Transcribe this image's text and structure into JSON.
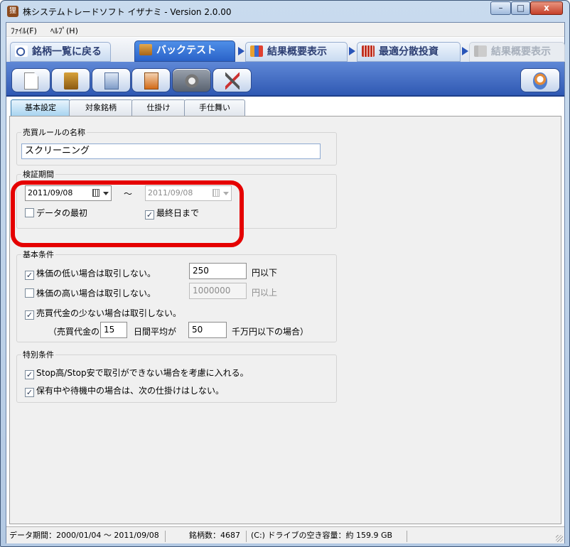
{
  "window": {
    "title": "株システムトレードソフト イザナミ - Version 2.0.00",
    "app_icon": "tanuki-app-icon",
    "controls": {
      "minimize": "–",
      "maximize": "□",
      "close": "x"
    }
  },
  "menu": {
    "file": "ﾌｧｲﾙ(F)",
    "help": "ﾍﾙﾌﾟ(H)"
  },
  "nav": {
    "back": "銘柄一覧に戻る",
    "backtest": "バックテスト",
    "summary": "結果概要表示",
    "optimize": "最適分散投資",
    "summary2": "結果概要表示"
  },
  "toolbar": {
    "icons": [
      "new-document-icon",
      "open-folder-icon",
      "export-icon",
      "import-icon",
      "run-gear-icon",
      "settings-tools-icon",
      "help-icon"
    ]
  },
  "tabs": {
    "basic": "基本設定",
    "stocks": "対象銘柄",
    "entry": "仕掛け",
    "exit": "手仕舞い"
  },
  "rule_name": {
    "caption": "売買ルールの名称",
    "value": "スクリーニング"
  },
  "period": {
    "caption": "検証期間",
    "start_date": "2011/09/08",
    "separator": "～",
    "end_date": "2011/09/08",
    "from_first_label": "データの最初",
    "from_first_checked": false,
    "to_last_label": "最終日まで",
    "to_last_checked": true,
    "highlight_color": "#e50000"
  },
  "basic": {
    "caption": "基本条件",
    "low_price_label": "株価の低い場合は取引しない。",
    "low_price_checked": true,
    "low_price_value": "250",
    "low_price_unit": "円以下",
    "high_price_label": "株価の高い場合は取引しない。",
    "high_price_checked": false,
    "high_price_value": "1000000",
    "high_price_unit": "円以上",
    "volume_label": "売買代金の少ない場合は取引しない。",
    "volume_checked": true,
    "volume_prefix": "（売買代金の",
    "volume_days": "15",
    "volume_mid": "日間平均が",
    "volume_amount": "50",
    "volume_suffix": "千万円以下の場合）"
  },
  "special": {
    "caption": "特別条件",
    "stop_label": "Stop高/Stop安で取引ができない場合を考慮に入れる。",
    "stop_checked": true,
    "hold_label": "保有中や待機中の場合は、次の仕掛けはしない。",
    "hold_checked": true
  },
  "status": {
    "period": "データ期間：2000/01/04 ～ 2011/09/08",
    "count": "銘柄数：4687",
    "disk": "(C:) ドライブの空き容量：約 159.9 GB"
  }
}
